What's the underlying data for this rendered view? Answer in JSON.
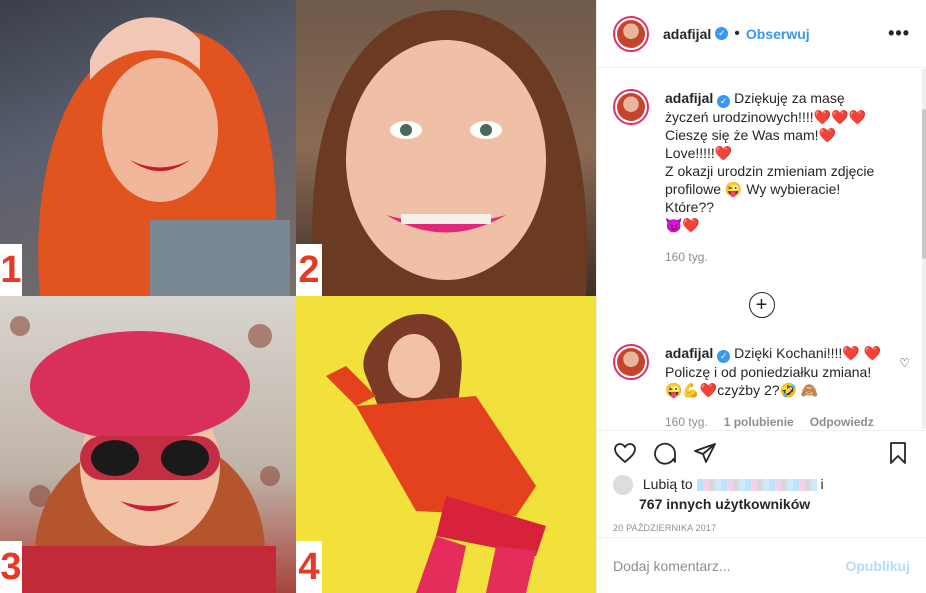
{
  "photos": [
    {
      "number": "1"
    },
    {
      "number": "2"
    },
    {
      "number": "3"
    },
    {
      "number": "4"
    }
  ],
  "header": {
    "username": "adafijal",
    "follow_label": "Obserwuj",
    "more_icon": "more-horizontal-icon"
  },
  "caption": {
    "username": "adafijal",
    "text_line1": "Dziękuję za masę życzeń urodzinowych!!!!",
    "text_line2": "Cieszę się że Was mam!",
    "text_line3": "Love!!!!!",
    "text_line4": "Z okazji urodzin zmieniam zdjęcie profilowe 😜 Wy wybieracie! Które??",
    "emoji_tail": "😈❤️",
    "time": "160 tyg."
  },
  "load_more_icon": "plus-circle-icon",
  "comment": {
    "username": "adafijal",
    "text": "Dzięki Kochani!!!!❤️ ❤️ Policzę i od poniedziałku zmiana! 😜💪❤️czyżby 2?🤣 🙈",
    "time": "160 tyg.",
    "likes": "1 polubienie",
    "reply_label": "Odpowiedz"
  },
  "actions": {
    "like_icon": "heart-icon",
    "comment_icon": "comment-icon",
    "share_icon": "share-icon",
    "save_icon": "bookmark-icon"
  },
  "likes": {
    "prefix": "Lubią to",
    "and": "i",
    "count_text": "767 innych użytkowników"
  },
  "date": "20 PAŹDZIERNIKA 2017",
  "add_comment": {
    "placeholder": "Dodaj komentarz...",
    "post_label": "Opublikuj"
  },
  "colors": {
    "accent": "#3897f0",
    "number_red": "#e53b26",
    "yellow_bg": "#f1e13a"
  }
}
